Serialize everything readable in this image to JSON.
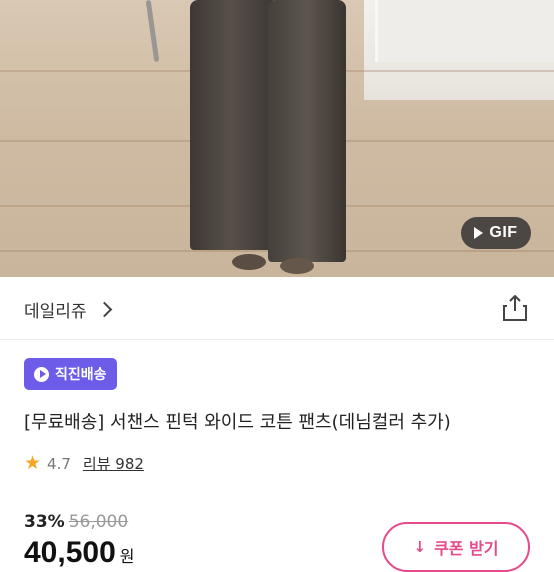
{
  "media": {
    "gif_label": "GIF",
    "icons": [
      "play-icon"
    ]
  },
  "shop": {
    "name": "데일리쥬",
    "icons": [
      "chevron-right-icon",
      "share-icon"
    ]
  },
  "product": {
    "badge_label": "직진배송",
    "title": "[무료배송] 서챈스 핀턱 와이드 코튼 팬츠(데님컬러 추가)",
    "rating": "4.7",
    "reviews_label": "리뷰 982",
    "discount": "33%",
    "original_price": "56,000",
    "price": "40,500",
    "currency": "원"
  },
  "coupon": {
    "label": "쿠폰 받기"
  },
  "colors": {
    "badge_bg": "#6c5ce7",
    "coupon_accent": "#e64a8a",
    "star": "#f5a623"
  }
}
